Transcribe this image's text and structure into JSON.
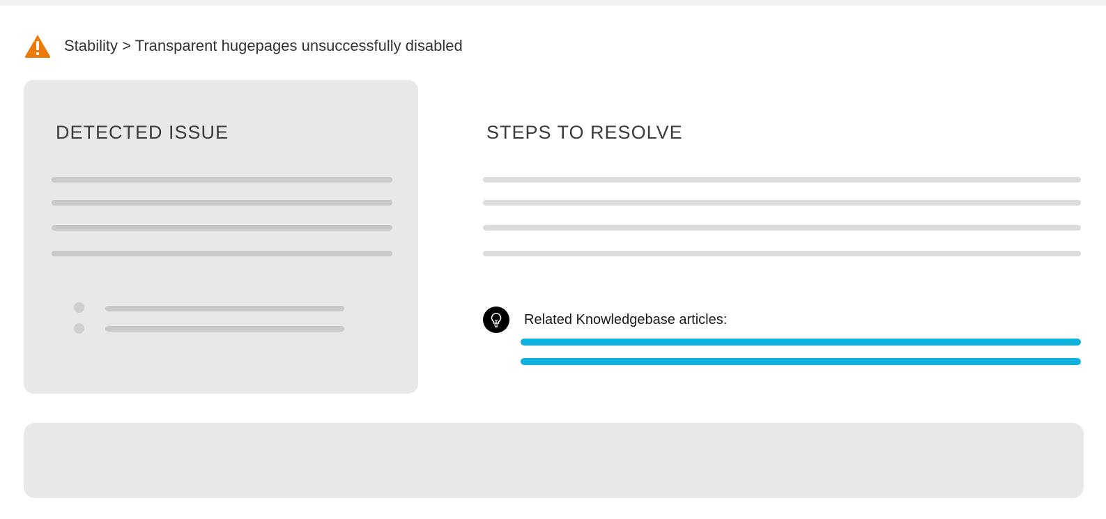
{
  "header": {
    "icon": "warning-triangle-icon",
    "breadcrumb": "Stability > Transparent hugepages unsuccessfully disabled"
  },
  "detected_issue": {
    "title": "DETECTED ISSUE"
  },
  "steps_to_resolve": {
    "title": "STEPS TO RESOLVE",
    "kb_icon": "lightbulb-icon",
    "kb_label": "Related Knowledgebase articles:"
  },
  "colors": {
    "warning": "#ec7a08",
    "link": "#0db0db",
    "panel": "#e8e8e8"
  }
}
